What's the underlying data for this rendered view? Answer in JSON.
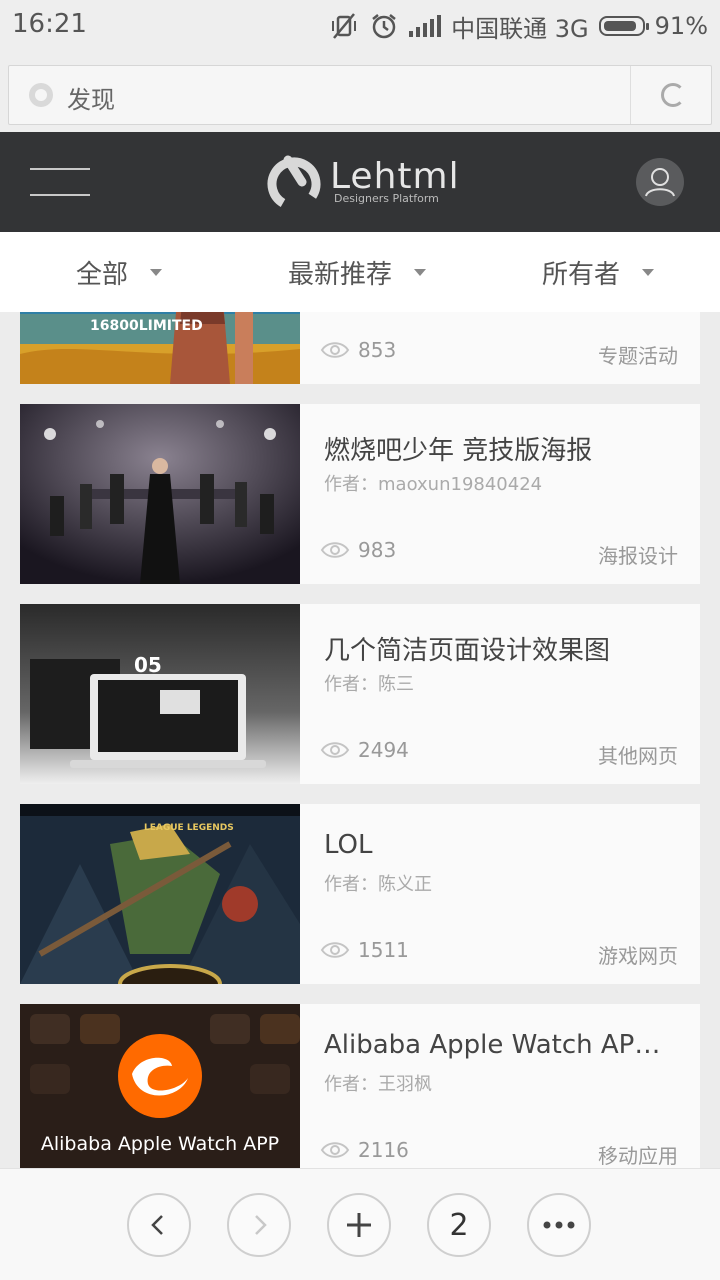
{
  "status_bar": {
    "time": "16:21",
    "carrier": "中国联通 3G",
    "battery_percent": "91%",
    "battery_level": 0.91
  },
  "address_bar": {
    "url_text": "发现"
  },
  "site_header": {
    "logo_word": "Lehtml",
    "logo_tagline": "Designers Platform"
  },
  "filters": [
    {
      "label": "全部"
    },
    {
      "label": "最新推荐"
    },
    {
      "label": "所有者"
    }
  ],
  "cards": [
    {
      "title": "",
      "author": "",
      "views": "853",
      "category": "专题活动",
      "thumb_text": "16800LIMITED"
    },
    {
      "title": "燃烧吧少年 竞技版海报",
      "author": "作者：maoxun19840424",
      "views": "983",
      "category": "海报设计"
    },
    {
      "title": "几个简洁页面设计效果图",
      "author": "作者：陈三",
      "views": "2494",
      "category": "其他网页",
      "thumb_text": "05"
    },
    {
      "title": "LOL",
      "author": "作者：陈义正",
      "views": "1511",
      "category": "游戏网页",
      "thumb_text": "LEAGUE LEGENDS"
    },
    {
      "title": "Alibaba Apple Watch APP ...",
      "author": "作者：王羽枫",
      "views": "2116",
      "category": "移动应用",
      "thumb_text": "Alibaba Apple Watch APP"
    }
  ],
  "bottom_nav": {
    "tab_count": "2"
  },
  "colors": {
    "header_bg": "#333436",
    "alibaba_orange": "#ff6a00"
  }
}
